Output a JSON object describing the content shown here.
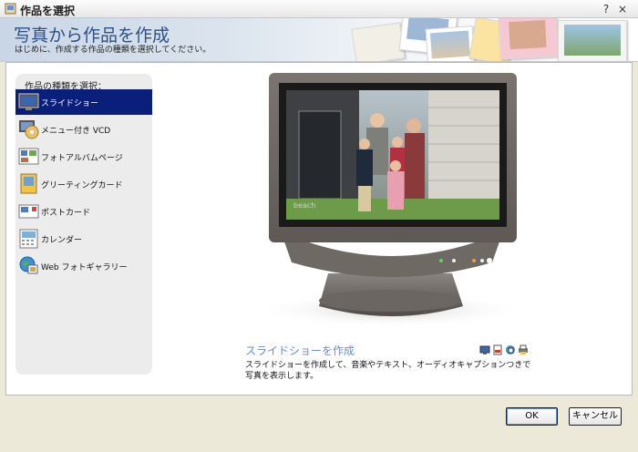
{
  "window": {
    "title": "作品を選択",
    "help": "?",
    "close": "×"
  },
  "header": {
    "title": "写真から作品を作成",
    "subtitle": "はじめに、作成する作品の種類を選択してください。"
  },
  "sidebar": {
    "heading": "作品の種類を選択：",
    "items": [
      {
        "label": "スライドショー",
        "icon": "slideshow-icon",
        "selected": true
      },
      {
        "label": "メニュー付き VCD",
        "icon": "vcd-disc-icon",
        "selected": false
      },
      {
        "label": "フォトアルバムページ",
        "icon": "album-page-icon",
        "selected": false
      },
      {
        "label": "グリーティングカード",
        "icon": "greeting-card-icon",
        "selected": false
      },
      {
        "label": "ポストカード",
        "icon": "postcard-icon",
        "selected": false
      },
      {
        "label": "カレンダー",
        "icon": "calendar-icon",
        "selected": false
      },
      {
        "label": "Web フォトギャラリー",
        "icon": "web-gallery-icon",
        "selected": false
      }
    ]
  },
  "preview": {
    "title": "スライドショーを作成",
    "description": "スライドショーを作成して、音楽やテキスト、オーディオキャプションつきで写真を表示します。",
    "output_icons": [
      "screen-output-icon",
      "pdf-output-icon",
      "share-output-icon",
      "print-output-icon"
    ],
    "monitor_sign_text": "beach"
  },
  "buttons": {
    "ok": "OK",
    "cancel": "キャンセル"
  },
  "colors": {
    "accent": "#2f4f86",
    "selection": "#0a1f7a",
    "subtitle_blue": "#6a8cc7"
  }
}
